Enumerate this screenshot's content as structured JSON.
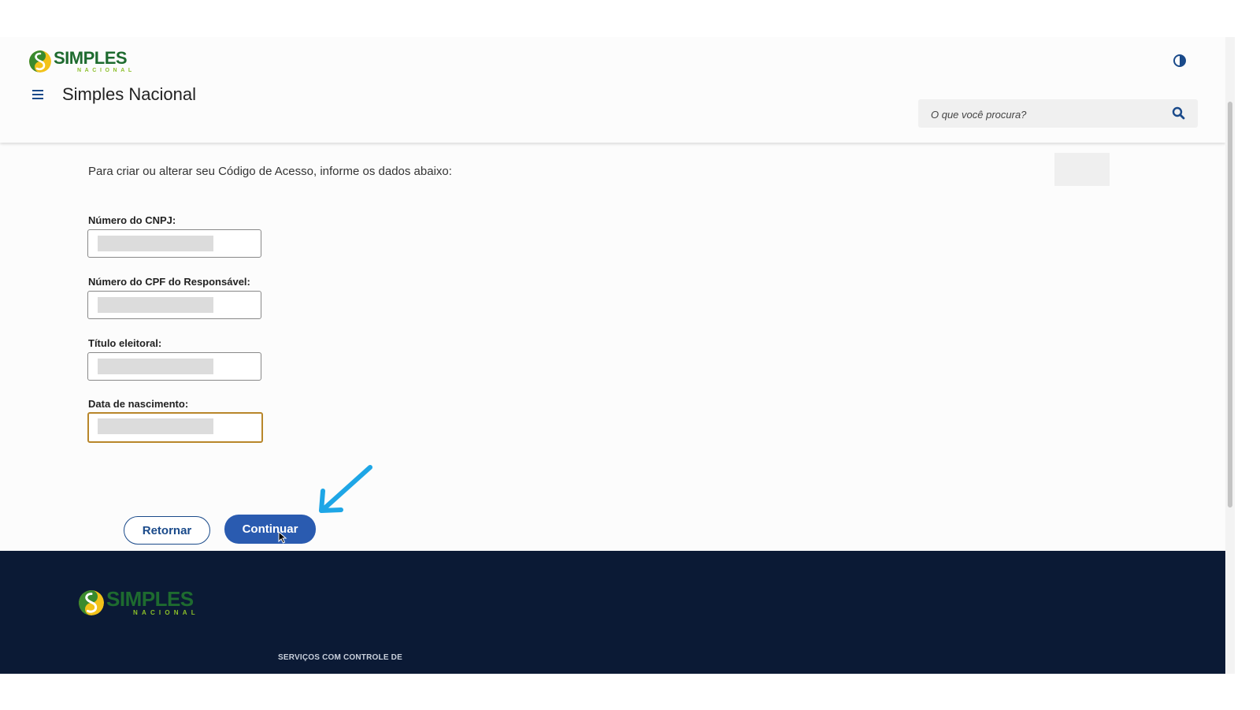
{
  "header": {
    "logo": {
      "word1": "SIMPLES",
      "word2": "NACIONAL"
    },
    "site_title": "Simples Nacional",
    "search_placeholder": "O que você procura?",
    "icons": {
      "menu": "hamburger-menu-icon",
      "contrast": "contrast-icon",
      "search": "magnifier-search-icon"
    }
  },
  "form": {
    "intro": "Para criar ou alterar seu Código de Acesso, informe os dados abaixo:",
    "fields": [
      {
        "label": "Número do CNPJ:"
      },
      {
        "label": "Número do CPF do Responsável:"
      },
      {
        "label": "Título eleitoral:"
      },
      {
        "label": "Data de nascimento:"
      }
    ],
    "buttons": {
      "back": "Retornar",
      "continue": "Continuar"
    }
  },
  "footer": {
    "logo": {
      "word1": "SIMPLES",
      "word2": "NACIONAL"
    },
    "text": "SERVIÇOS COM CONTROLE DE"
  },
  "colors": {
    "primary_button": "#2a5bb0",
    "outline_button": "#1a4a8a",
    "focus_border": "#b8862a",
    "footer_bg": "#0b1a35",
    "logo_green": "#1e6b2f",
    "logo_light_green": "#8bbf2a",
    "logo_yellow": "#f2c21a",
    "annotation_arrow": "#1ea6e6"
  }
}
